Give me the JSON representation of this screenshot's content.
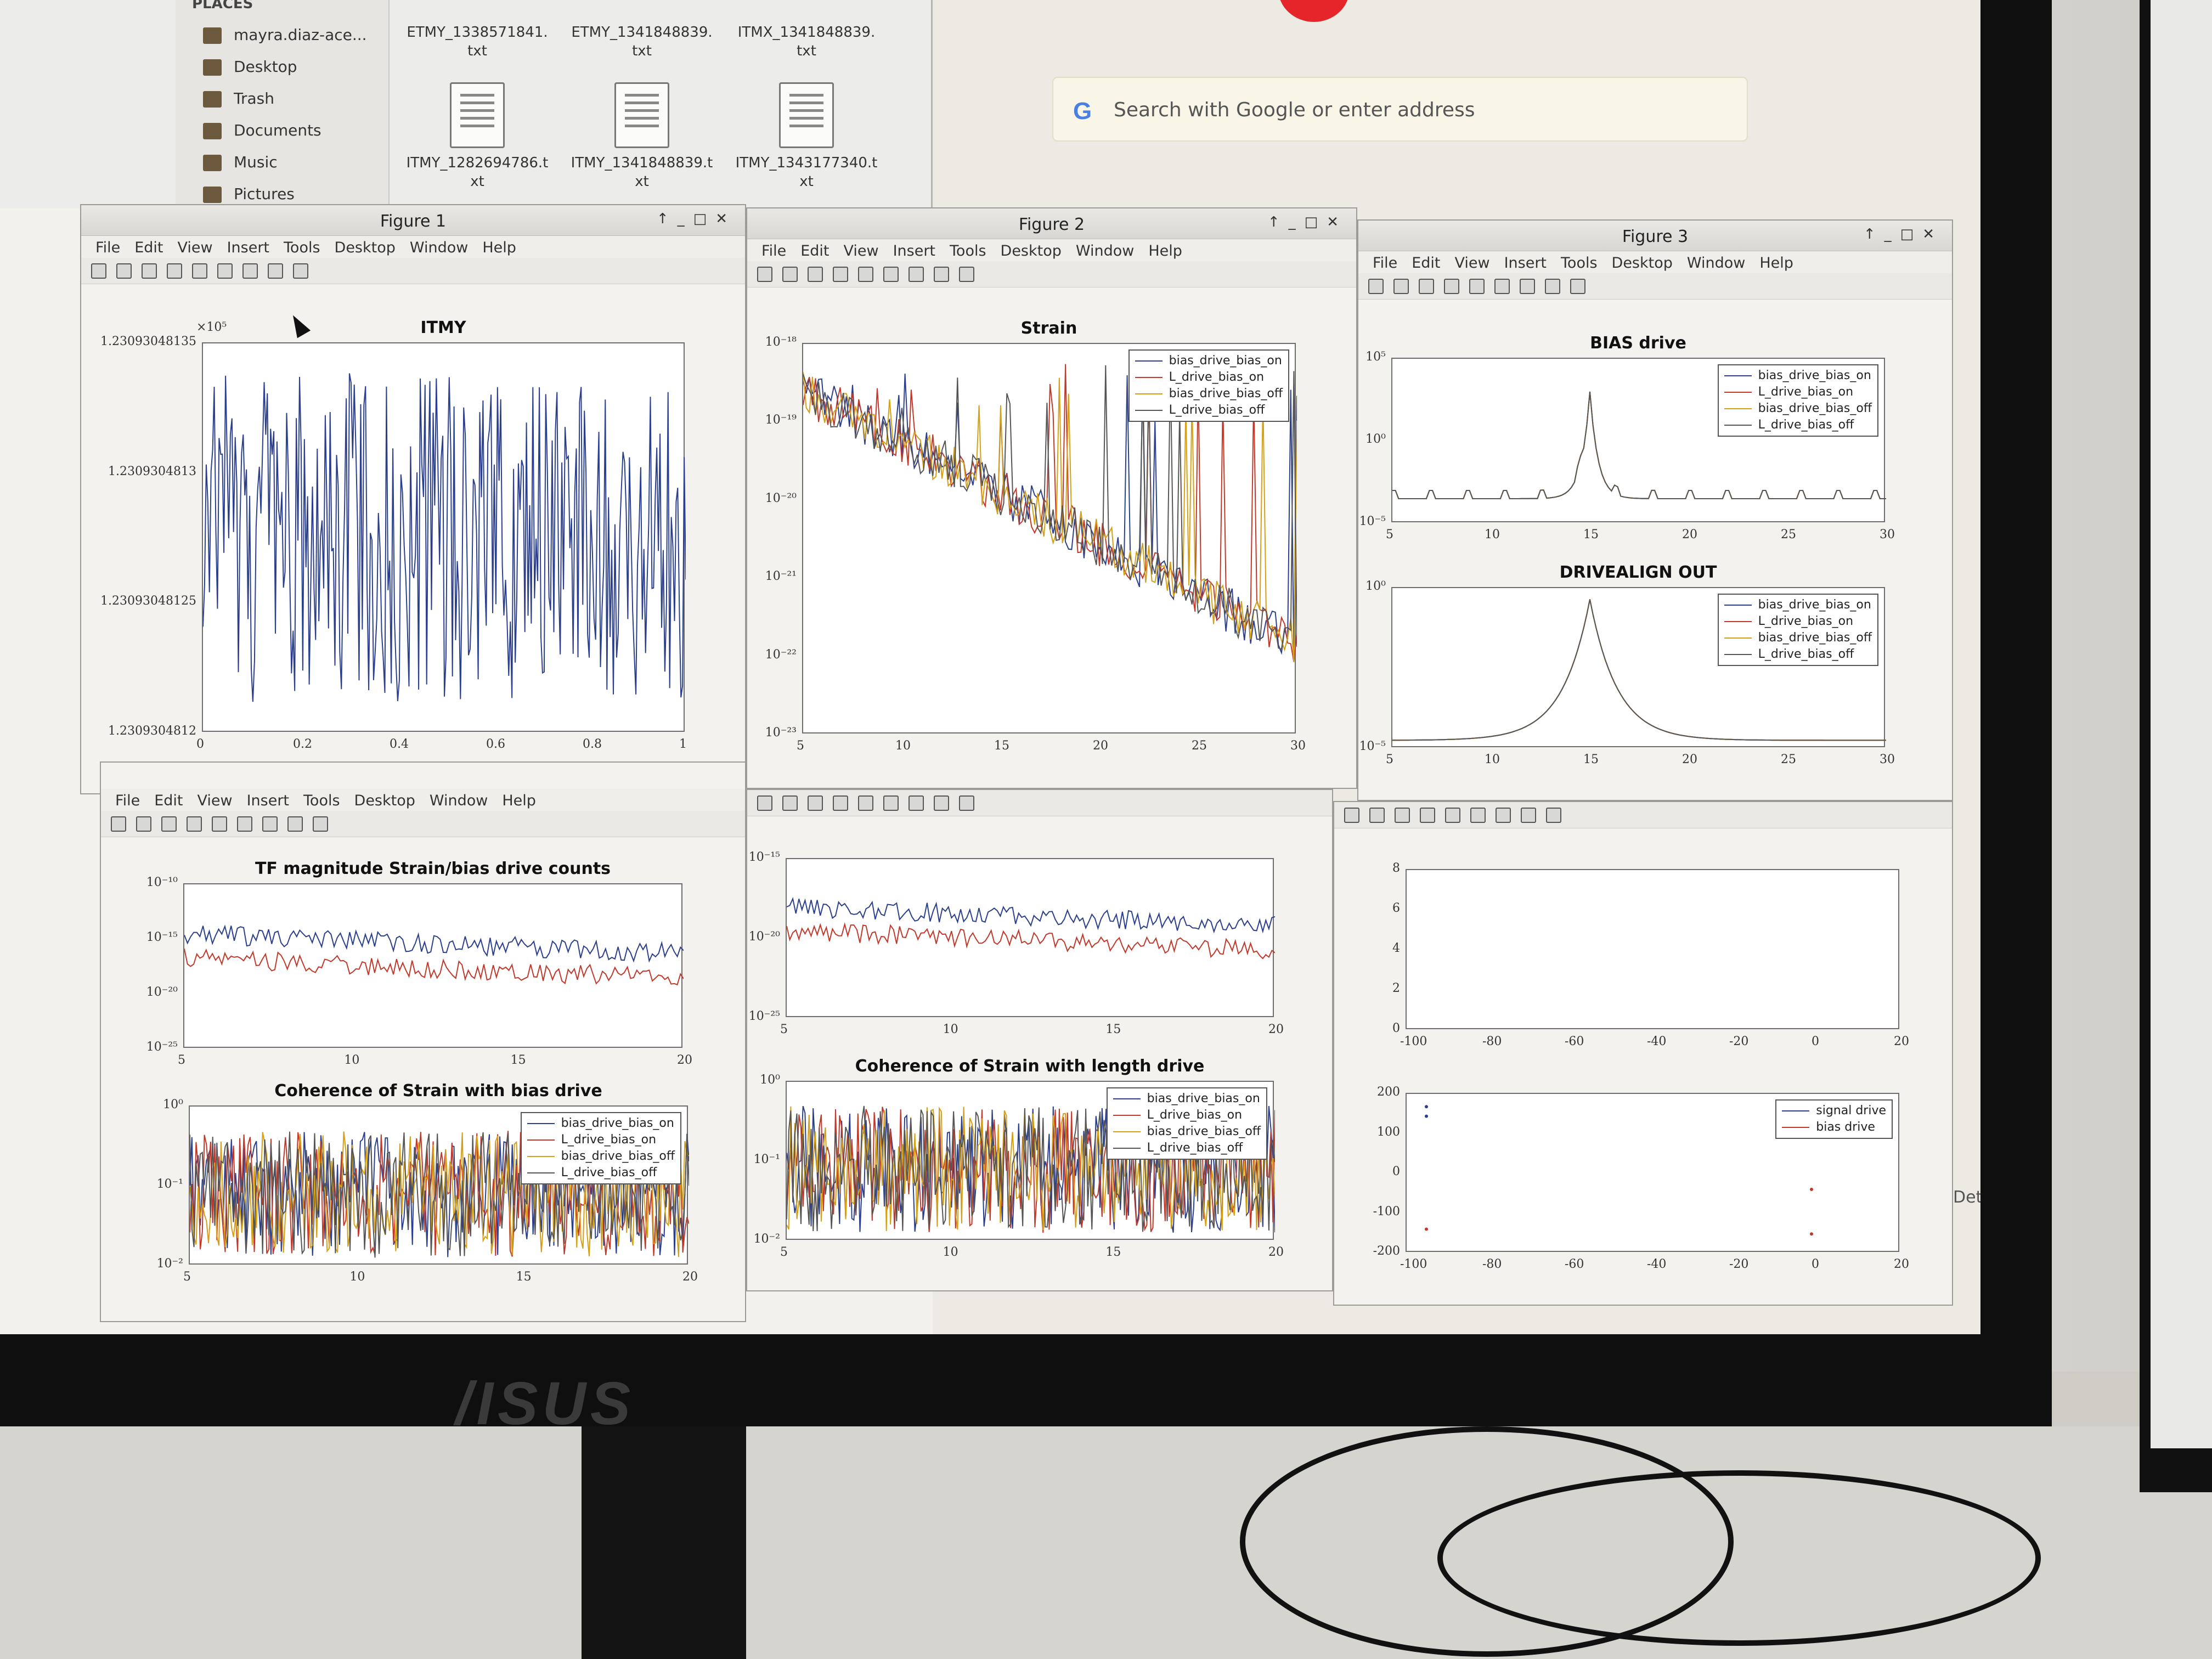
{
  "file_manager": {
    "places_header": "PLACES",
    "places": [
      "mayra.diaz-ace...",
      "Desktop",
      "Trash",
      "Documents",
      "Music",
      "Pictures"
    ],
    "files_row1": [
      "ETMY_1338571841.\ntxt",
      "ETMY_1341848839.\ntxt",
      "ITMX_1341848839.\ntxt"
    ],
    "files_row2": [
      "ITMY_1282694786.t\nxt",
      "ITMY_1341848839.t\nxt",
      "ITMY_1343177340.t\nxt"
    ]
  },
  "browser": {
    "search_icon": "google-g-icon",
    "search_placeholder": "Search with Google or enter address"
  },
  "monitor_brand": "/ISUS",
  "menu": [
    "File",
    "Edit",
    "View",
    "Insert",
    "Tools",
    "Desktop",
    "Window",
    "Help"
  ],
  "windows": {
    "fig1": {
      "title": "Figure 1"
    },
    "fig2": {
      "title": "Figure 2"
    },
    "fig3": {
      "title": "Figure 3"
    }
  },
  "plots": {
    "itmy": {
      "title": "ITMY",
      "exp": "×10⁵",
      "yticks": [
        "1.23093048135",
        "1.2309304813",
        "1.23093048125",
        "1.2309304812"
      ],
      "xticks": [
        "0",
        "0.2",
        "0.4",
        "0.6",
        "0.8",
        "1"
      ]
    },
    "strain": {
      "title": "Strain",
      "yticks": [
        "10⁻¹⁸",
        "10⁻¹⁹",
        "10⁻²⁰",
        "10⁻²¹",
        "10⁻²²",
        "10⁻²³"
      ],
      "xticks": [
        "5",
        "10",
        "15",
        "20",
        "25",
        "30"
      ],
      "legend": [
        "bias_drive_bias_on",
        "L_drive_bias_on",
        "bias_drive_bias_off",
        "L_drive_bias_off"
      ]
    },
    "bias_drive": {
      "title": "BIAS drive",
      "yticks": [
        "10⁵",
        "10⁰",
        "10⁻⁵"
      ],
      "xticks": [
        "5",
        "10",
        "15",
        "20",
        "25",
        "30"
      ],
      "legend": [
        "bias_drive_bias_on",
        "L_drive_bias_on",
        "bias_drive_bias_off",
        "L_drive_bias_off"
      ]
    },
    "drivealign": {
      "title": "DRIVEALIGN OUT",
      "yticks": [
        "10⁰",
        "10⁻⁵"
      ],
      "xticks": [
        "5",
        "10",
        "15",
        "20",
        "25",
        "30"
      ],
      "legend": [
        "bias_drive_bias_on",
        "L_drive_bias_on",
        "bias_drive_bias_off",
        "L_drive_bias_off"
      ]
    },
    "tf_bias": {
      "title": "TF magnitude Strain/bias drive counts",
      "yticks": [
        "10⁻¹⁰",
        "10⁻¹⁵",
        "10⁻²⁰",
        "10⁻²⁵"
      ],
      "xticks": [
        "5",
        "10",
        "15",
        "20"
      ]
    },
    "tf_length": {
      "yticks": [
        "10⁻¹⁵",
        "10⁻²⁰",
        "10⁻²⁵"
      ],
      "xticks": [
        "5",
        "10",
        "15",
        "20"
      ]
    },
    "coh_bias": {
      "title": "Coherence of Strain with bias drive",
      "yticks": [
        "10⁰",
        "10⁻¹",
        "10⁻²"
      ],
      "xticks": [
        "5",
        "10",
        "15",
        "20"
      ],
      "legend": [
        "bias_drive_bias_on",
        "L_drive_bias_on",
        "bias_drive_bias_off",
        "L_drive_bias_off"
      ]
    },
    "coh_length": {
      "title": "Coherence of Strain with length drive",
      "yticks": [
        "10⁰",
        "10⁻¹",
        "10⁻²"
      ],
      "xticks": [
        "5",
        "10",
        "15",
        "20"
      ],
      "legend": [
        "bias_drive_bias_on",
        "L_drive_bias_on",
        "bias_drive_bias_off",
        "L_drive_bias_off"
      ]
    },
    "scatter_top": {
      "yticks": [
        "8",
        "6",
        "4",
        "2",
        "0"
      ],
      "xticks": [
        "-100",
        "-80",
        "-60",
        "-40",
        "-20",
        "0",
        "20"
      ]
    },
    "scatter_bottom": {
      "yticks": [
        "200",
        "100",
        "0",
        "-100",
        "-200"
      ],
      "xticks": [
        "-100",
        "-80",
        "-60",
        "-40",
        "-20",
        "0",
        "20"
      ],
      "legend": [
        "signal drive",
        "bias drive"
      ]
    }
  },
  "side_label": "Det."
}
